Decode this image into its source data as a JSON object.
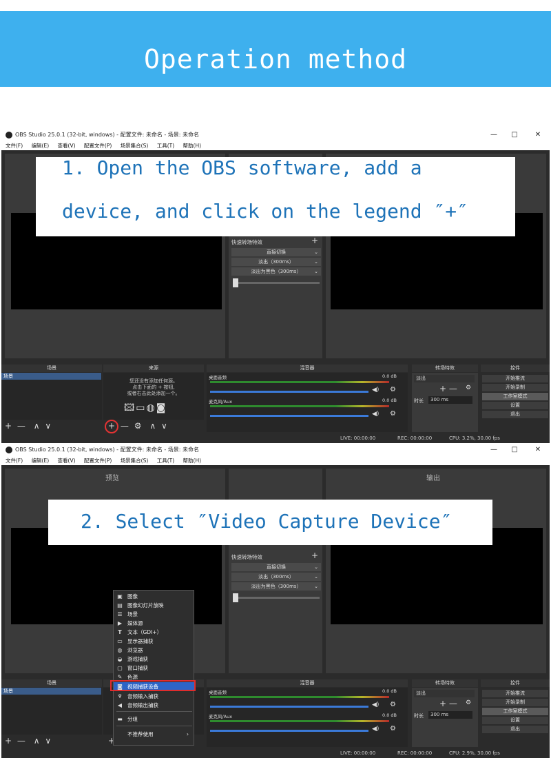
{
  "header": {
    "title": "Operation method"
  },
  "window": {
    "title": "OBS Studio 25.0.1 (32-bit, windows) - 配置文件: 未命名 - 场景: 未命名",
    "min": "—",
    "max": "□",
    "close": "✕",
    "menu": [
      "文件(F)",
      "编辑(E)",
      "查看(V)",
      "配置文件(P)",
      "场景集合(S)",
      "工具(T)",
      "帮助(H)"
    ]
  },
  "panes": {
    "preview": "预览",
    "output": "输出"
  },
  "transitions_mid": {
    "quick_label": "快速转场特效",
    "add": "+",
    "rows": [
      "直接切换",
      "淡出（300ms）",
      "淡出为黑色（300ms）"
    ]
  },
  "docks": {
    "scenes": "场景",
    "sources": "来源",
    "mixer": "混音器",
    "transitions": "转场特效",
    "controls": "控件"
  },
  "scene_item": "场景",
  "sources_hint": [
    "您还没有添加任何源。",
    "点击下面的 + 按钮,",
    "或者右击此处添加一个。"
  ],
  "mixer": {
    "track1": "桌面音频",
    "track1_db": "0.0 dB",
    "track2": "麦克风/Aux",
    "track2_db": "0.0 dB"
  },
  "transition_panel": {
    "value": "淡出",
    "duration_label": "时长",
    "duration_value": "300 ms"
  },
  "controls": [
    "开始推流",
    "开始录制",
    "工作室模式",
    "设置",
    "退出"
  ],
  "status1": {
    "live": "LIVE: 00:00:00",
    "rec": "REC: 00:00:00",
    "cpu": "CPU: 3.2%, 30.00 fps"
  },
  "status2": {
    "live": "LIVE: 00:00:00",
    "rec": "REC: 00:00:00",
    "cpu": "CPU: 2.9%, 30.00 fps"
  },
  "toolbar": {
    "add": "+",
    "remove": "—",
    "settings": "⚙",
    "up": "∧",
    "down": "∨"
  },
  "step1": {
    "line1": "1. Open the OBS software, add a",
    "line2": "device, and click on the legend ″+″"
  },
  "step2": {
    "text": "2. Select ″Video Capture Device″"
  },
  "context_menu": {
    "items": [
      {
        "label": "图像",
        "icon": "image-icon"
      },
      {
        "label": "图像幻灯片放映",
        "icon": "slideshow-icon"
      },
      {
        "label": "场景",
        "icon": "scene-list-icon"
      },
      {
        "label": "媒体源",
        "icon": "play-icon"
      },
      {
        "label": "文本（GDI+）",
        "icon": "text-icon"
      },
      {
        "label": "显示器捕获",
        "icon": "monitor-icon"
      },
      {
        "label": "浏览器",
        "icon": "globe-icon"
      },
      {
        "label": "游戏捕获",
        "icon": "gamepad-icon"
      },
      {
        "label": "窗口捕获",
        "icon": "window-icon"
      },
      {
        "label": "色源",
        "icon": "brush-icon"
      },
      {
        "label": "视频捕获设备",
        "icon": "camera-icon"
      },
      {
        "label": "音频输入捕获",
        "icon": "microphone-icon"
      },
      {
        "label": "音频输出捕获",
        "icon": "speaker-icon"
      },
      {
        "label": "分组",
        "icon": "folder-icon"
      },
      {
        "label": "不推荐使用",
        "icon": "submenu-arrow-icon"
      }
    ]
  },
  "colors": {
    "header": "#3eb0ee",
    "callout_text": "#1e73b8",
    "highlight": "#e53333",
    "selected": "#2c64c6"
  }
}
